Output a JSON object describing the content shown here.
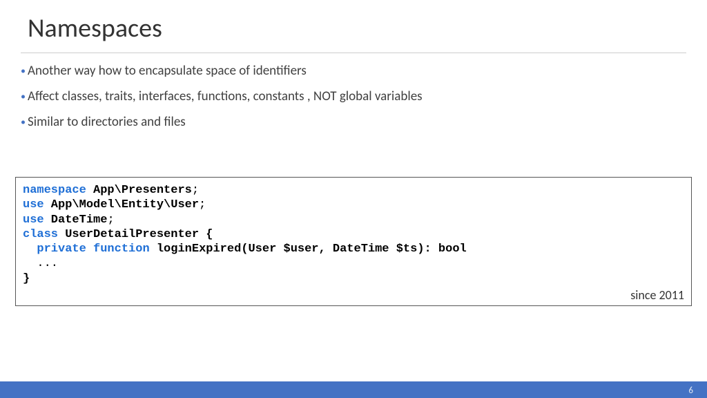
{
  "title": "Namespaces",
  "bullets": [
    "Another way how to encapsulate space of identifiers",
    "Affect classes, traits, interfaces, functions, constants , NOT global variables",
    "Similar to directories and files"
  ],
  "code": {
    "l1_kw": "namespace",
    "l1_name": " App\\Presenters",
    "l1_tail": ";",
    "l2_kw": "use",
    "l2_name": " App\\Model\\Entity\\User",
    "l2_tail": ";",
    "l3_kw": "use",
    "l3_name": " DateTime",
    "l3_tail": ";",
    "blank": "",
    "l4_kw": "class",
    "l4_name": " UserDetailPresenter {",
    "l5_indent": "  ",
    "l5_kw1": "private",
    "l5_sp": " ",
    "l5_kw2": "function",
    "l5_name": " loginExpired(User $user, DateTime $ts): bool",
    "l6": "  ...",
    "l7_name": "}"
  },
  "since": "since 2011",
  "pageNumber": "6"
}
